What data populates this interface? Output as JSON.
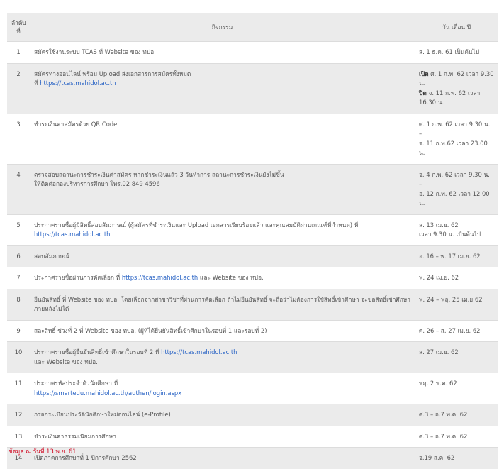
{
  "header": {
    "no": "ลำดับที่",
    "activity": "กิจกรรม",
    "date": "วัน เดือน ปี"
  },
  "rows": [
    {
      "no": "1",
      "activity": "สมัครใช้งานระบบ TCAS ที่ Website ของ ทปอ.",
      "date": "ส. 1 ธ.ค. 61 เป็นต้นไป"
    },
    {
      "no": "2",
      "activity": "สมัครทางออนไลน์ พร้อม Upload ส่งเอกสารการสมัครทั้งหมด",
      "activity2": "ที่",
      "link": "https://tcas.mahidol.ac.th",
      "date_open_label": "เปิด",
      "date_open": "ศ. 1 ก.พ. 62 เวลา 9.30 น.",
      "date_close_label": "ปิด",
      "date_close": "จ. 11 ก.พ. 62 เวลา 16.30 น."
    },
    {
      "no": "3",
      "activity": "ชำระเงินค่าสมัครด้วย QR Code",
      "date_line1": "ศ. 1 ก.พ. 62 เวลา 9.30 น.",
      "date_line2": "–",
      "date_line3": "จ. 11 ก.พ.62 เวลา 23.00 น."
    },
    {
      "no": "4",
      "activity": "ตรวจสอบสถานะการชำระเงินค่าสมัคร หากชำระเงินแล้ว 3 วันทำการ สถานะการชำระเงินยังไม่ขึ้น",
      "activity2": "ให้ติดต่อกองบริหารการศึกษา โทร.02 849 4596",
      "date_line1": "จ. 4 ก.พ. 62 เวลา 9.30 น.",
      "date_line2": "–",
      "date_line3": "อ. 12 ก.พ. 62 เวลา 12.00 น."
    },
    {
      "no": "5",
      "activity": "ประกาศรายชื่อผู้มีสิทธิ์สอบสัมภาษณ์ (ผู้สมัครที่ชำระเงินและ Upload เอกสารเรียบร้อยแล้ว และคุณสมบัติผ่านเกณฑ์ที่กำหนด) ที่",
      "link": "https://tcas.mahidol.ac.th",
      "date_line1": "ส. 13 เม.ย. 62",
      "date_line2": "เวลา 9.30 น. เป็นต้นไป"
    },
    {
      "no": "6",
      "activity": "สอบสัมภาษณ์",
      "date": "อ. 16 – พ. 17 เม.ย. 62"
    },
    {
      "no": "7",
      "activity": "ประกาศรายชื่อผ่านการคัดเลือก ที่",
      "link": "https://tcas.mahidol.ac.th",
      "activity_after": "และ Website ของ ทปอ.",
      "date": "พ. 24 เม.ย. 62"
    },
    {
      "no": "8",
      "activity": "ยืนยันสิทธิ์ ที่ Website ของ ทปอ. โดยเลือกจากสาขาวิชาที่ผ่านการคัดเลือก ถ้าไม่ยืนยันสิทธิ์ จะถือว่าไม่ต้องการใช้สิทธิ์เข้าศึกษา จะขอสิทธิ์เข้าศึกษาภายหลังไม่ได้",
      "date": "พ. 24 – พฤ. 25 เม.ย.62"
    },
    {
      "no": "9",
      "activity": "สละสิทธิ์ ช่วงที่ 2 ที่ Website ของ ทปอ. (ผู้ที่ได้ยืนยันสิทธิ์เข้าศึกษาในรอบที่ 1 และรอบที่ 2)",
      "date": "ศ. 26 – ส. 27 เม.ย. 62"
    },
    {
      "no": "10",
      "activity": "ประกาศรายชื่อผู้ยืนยันสิทธิ์เข้าศึกษาในรอบที่ 2 ที่",
      "link": "https://tcas.mahidol.ac.th",
      "activity2": "และ Website ของ ทปอ.",
      "date": "ส. 27 เม.ย. 62"
    },
    {
      "no": "11",
      "activity": "ประกาศรหัสประจำตัวนักศึกษา ที่",
      "link": "https://smartedu.mahidol.ac.th/authen/login.aspx",
      "date": "พฤ. 2 พ.ค. 62"
    },
    {
      "no": "12",
      "activity": "กรอกระเบียนประวัตินักศึกษาใหม่ออนไลน์ (e-Profile)",
      "date": "ศ.3 – อ.7 พ.ค. 62"
    },
    {
      "no": "13",
      "activity": "ชำระเงินค่าธรรมเนียมการศึกษา",
      "date": "ศ.3 – อ.7 พ.ค. 62"
    },
    {
      "no": "14",
      "activity": "เปิดภาคการศึกษาที่ 1 ปีการศึกษา 2562",
      "date": "จ.19 ส.ค. 62"
    }
  ],
  "note": "ข้อมูล ณ วันที่ 13 พ.ย. 61",
  "colors": {
    "link": "#2a64c5",
    "note": "#d0021b",
    "row_shade": "#ebebeb"
  }
}
